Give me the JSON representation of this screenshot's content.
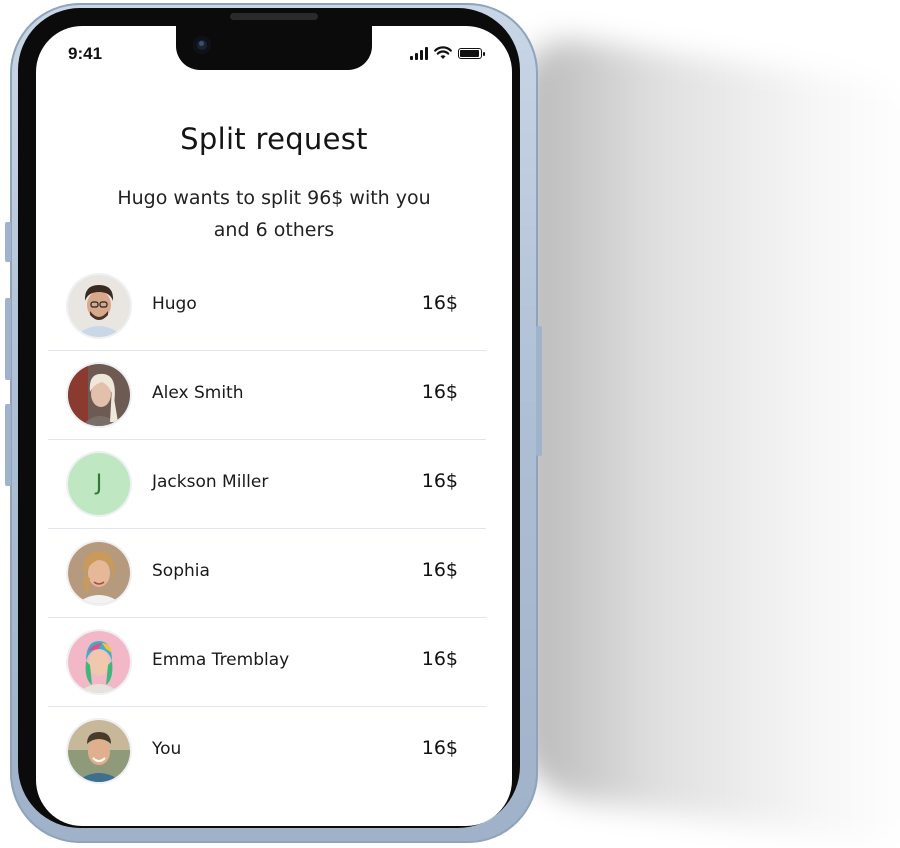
{
  "status_bar": {
    "time": "9:41",
    "icons": [
      "signal-icon",
      "wifi-icon",
      "battery-icon"
    ]
  },
  "screen": {
    "title": "Split request",
    "subtitle_line1": "Hugo wants to split 96$ with you",
    "subtitle_line2": "and 6 others"
  },
  "participants": [
    {
      "name": "Hugo",
      "amount": "16$",
      "avatar": "photo"
    },
    {
      "name": "Alex Smith",
      "amount": "16$",
      "avatar": "photo"
    },
    {
      "name": "Jackson Miller",
      "amount": "16$",
      "avatar": "initial",
      "initial": "J",
      "avatar_color": "#bfe8c2"
    },
    {
      "name": "Sophia",
      "amount": "16$",
      "avatar": "photo"
    },
    {
      "name": "Emma Tremblay",
      "amount": "16$",
      "avatar": "photo"
    },
    {
      "name": "You",
      "amount": "16$",
      "avatar": "photo"
    }
  ],
  "colors": {
    "frame": "#aebfd4",
    "divider": "#e2e4ee",
    "initial_avatar_bg": "#bfe8c2",
    "initial_avatar_text": "#2f7a3a"
  }
}
